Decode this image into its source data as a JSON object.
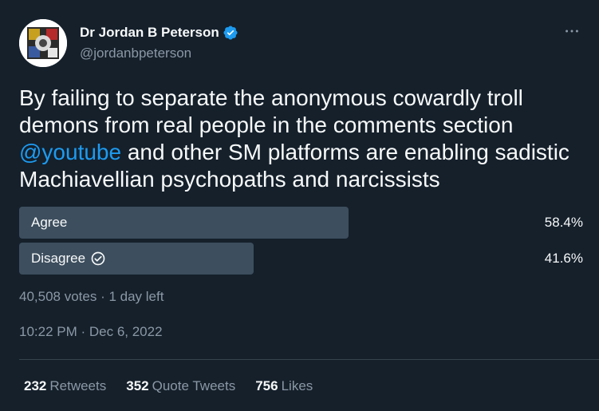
{
  "author": {
    "display_name": "Dr Jordan B Peterson",
    "handle": "@jordanbpeterson",
    "verified_icon": "verified-badge-icon"
  },
  "more_icon": "more-horizontal-icon",
  "tweet": {
    "text_before": "By failing to separate the anonymous cowardly troll demons from real people in the comments section ",
    "mention": "@youtube",
    "text_after": " and other SM platforms are enabling sadistic Machiavellian psychopaths and narcissists"
  },
  "poll": {
    "options": [
      {
        "label": "Agree",
        "percent": "58.4%",
        "fraction": 0.584,
        "selected": false
      },
      {
        "label": "Disagree",
        "percent": "41.6%",
        "fraction": 0.416,
        "selected": true
      }
    ],
    "meta": "40,508 votes · 1 day left"
  },
  "timestamp": "10:22 PM · Dec 6, 2022",
  "stats": {
    "retweets_count": "232",
    "retweets_label": "Retweets",
    "quotes_count": "352",
    "quotes_label": "Quote Tweets",
    "likes_count": "756",
    "likes_label": "Likes"
  },
  "colors": {
    "background": "#15202b",
    "accent": "#1d9bf0",
    "poll_bar": "#3d4e5e",
    "secondary_text": "#8b98a5"
  }
}
